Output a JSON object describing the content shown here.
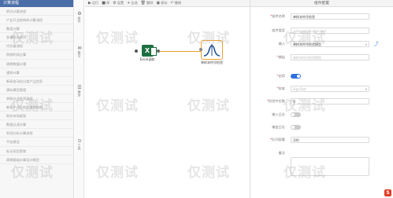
{
  "sidebar": {
    "title": "计算流程",
    "items": [
      "帆式计量流程",
      "产业开业结构的计算流程",
      "聚类计算",
      "多重时间序列",
      "代价者流程",
      "购物利润过算",
      "周期数据计量",
      "通知计算",
      "新闻自动化分类产品信息",
      "课标模型管理",
      "关联产业投资流程",
      "新客户评分前后流程构图",
      "财务市场规划",
      "数据过滤计算",
      "利润分析计算流程",
      "平台建设",
      "标识风险营销",
      "周期基础计算设计模型"
    ]
  },
  "rail": [
    {
      "glyph": "⚙",
      "label": "组件"
    },
    {
      "glyph": "✉",
      "label": "算法"
    },
    {
      "glyph": "☰",
      "label": "模型"
    },
    {
      "glyph": "⊙",
      "label": "工具"
    }
  ],
  "toolbar": {
    "run": "运行",
    "stop": "停",
    "settings": "设置",
    "select_all": "全选",
    "delete": "删除",
    "save": "保存",
    "undo": "撤销"
  },
  "canvas": {
    "excel_node_label": "Excel读取",
    "model_node_label": "单样本符号检验"
  },
  "panel": {
    "title": "组件配置",
    "fields": [
      {
        "label": "组件名称",
        "required": true,
        "value": "单样本符号检验",
        "kind": "input"
      },
      {
        "label": "组件类型",
        "required": false,
        "value": "unit.sample.sign.test",
        "kind": "input"
      },
      {
        "label": "输入",
        "required": false,
        "value": "单样本符号检验模型",
        "kind": "select",
        "share": true
      },
      {
        "label": "输出",
        "required": true,
        "value": "单样本符号检验模型",
        "kind": "input"
      },
      {
        "label": "启用",
        "required": true,
        "value": "",
        "kind": "toggle",
        "on": true
      },
      {
        "label": "样本",
        "required": true,
        "value": "SignTest",
        "kind": "select"
      },
      {
        "label": "检验中位数",
        "required": true,
        "value": "0",
        "kind": "input"
      },
      {
        "label": "输入日志",
        "required": false,
        "value": "",
        "kind": "toggle",
        "on": false
      },
      {
        "label": "输出日志",
        "required": false,
        "value": "",
        "kind": "toggle",
        "on": false
      },
      {
        "label": "队列容量",
        "required": true,
        "value": "100",
        "kind": "input"
      },
      {
        "label": "备注",
        "required": false,
        "value": "",
        "kind": "textarea"
      }
    ]
  },
  "watermark": "仅测试",
  "colors": {
    "accent": "#2f6fde",
    "header": "#4a6ea8",
    "node_border": "#f0a030",
    "excel": "#1d6f42",
    "required": "#e04040"
  }
}
